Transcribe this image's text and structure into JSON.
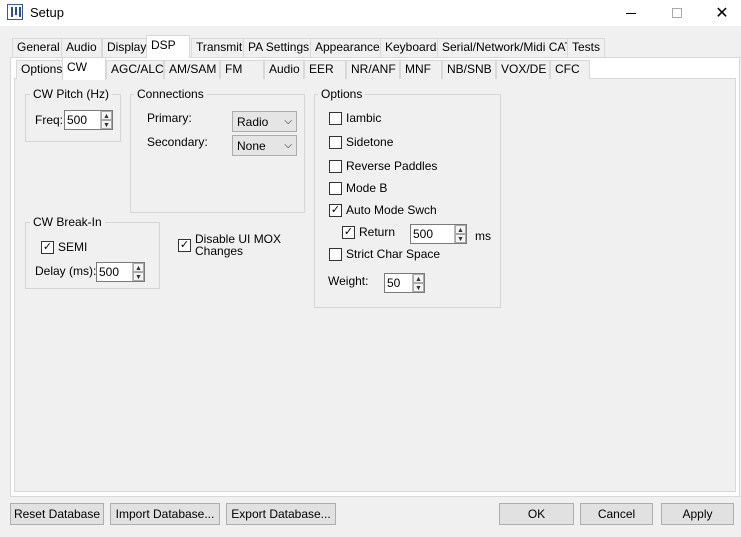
{
  "window": {
    "title": "Setup",
    "close_glyph": "✕"
  },
  "tabs": [
    {
      "label": "General"
    },
    {
      "label": "Audio"
    },
    {
      "label": "Display"
    },
    {
      "label": "DSP"
    },
    {
      "label": "Transmit"
    },
    {
      "label": "PA Settings"
    },
    {
      "label": "Appearance"
    },
    {
      "label": "Keyboard"
    },
    {
      "label": "Serial/Network/Midi CAT"
    },
    {
      "label": "Tests"
    }
  ],
  "selected_tab": "DSP",
  "subtabs": [
    {
      "label": "Options"
    },
    {
      "label": "CW"
    },
    {
      "label": "AGC/ALC"
    },
    {
      "label": "AM/SAM"
    },
    {
      "label": "FM"
    },
    {
      "label": "Audio"
    },
    {
      "label": "EER"
    },
    {
      "label": "NR/ANF"
    },
    {
      "label": "MNF"
    },
    {
      "label": "NB/SNB"
    },
    {
      "label": "VOX/DE"
    },
    {
      "label": "CFC"
    }
  ],
  "selected_subtab": "CW",
  "cw_pitch": {
    "title": "CW Pitch (Hz)",
    "freq_label": "Freq:",
    "freq_value": "500"
  },
  "connections": {
    "title": "Connections",
    "primary_label": "Primary:",
    "primary_value": "Radio",
    "secondary_label": "Secondary:",
    "secondary_value": "None"
  },
  "options": {
    "title": "Options",
    "iambic": {
      "label": "Iambic",
      "checked": false
    },
    "sidetone": {
      "label": "Sidetone",
      "checked": false
    },
    "reverse_paddles": {
      "label": "Reverse Paddles",
      "checked": false
    },
    "mode_b": {
      "label": "Mode B",
      "checked": false
    },
    "auto_mode_swch": {
      "label": "Auto Mode Swch",
      "checked": true
    },
    "return": {
      "label": "Return",
      "checked": true,
      "value": "500",
      "unit": "ms"
    },
    "strict_char_space": {
      "label": "Strict Char Space",
      "checked": false
    },
    "weight_label": "Weight:",
    "weight_value": "50"
  },
  "break_in": {
    "title": "CW Break-In",
    "semi": {
      "label": "SEMI",
      "checked": true
    },
    "delay_label": "Delay (ms):",
    "delay_value": "500"
  },
  "disable_mox": {
    "label_line1": "Disable UI MOX",
    "label_line2": "Changes",
    "checked": true
  },
  "bottom_buttons": {
    "reset": "Reset Database",
    "import": "Import Database...",
    "export": "Export Database...",
    "ok": "OK",
    "cancel": "Cancel",
    "apply": "Apply"
  },
  "glyphs": {
    "check": "✓",
    "up": "▲",
    "down": "▼",
    "chevron": "⌵"
  }
}
